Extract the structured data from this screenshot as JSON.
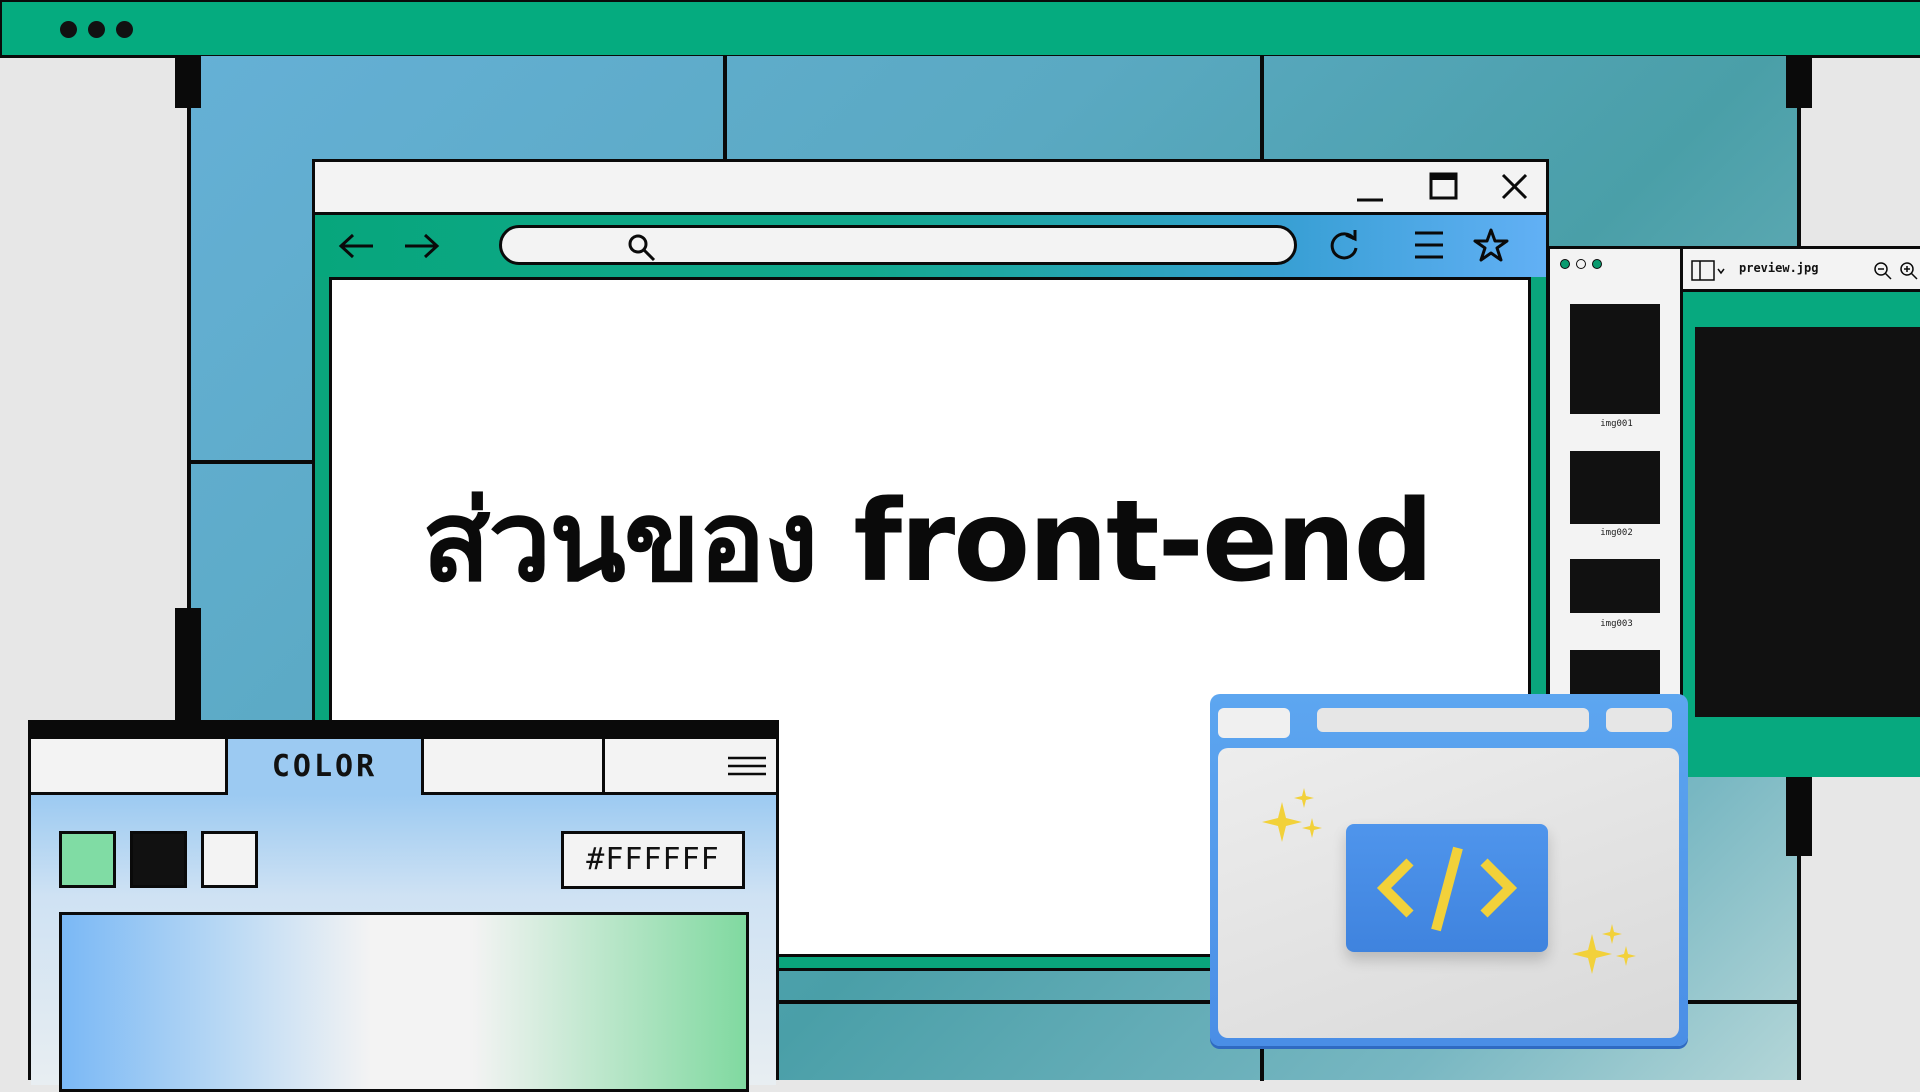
{
  "top_bar": {
    "window_dots": [
      "dot",
      "dot",
      "dot"
    ]
  },
  "browser": {
    "icons": {
      "minimize": "minimize-icon",
      "maximize": "maximize-icon",
      "close": "close-icon",
      "back": "arrow-left-icon",
      "forward": "arrow-right-icon",
      "search": "search-icon",
      "reload": "reload-icon",
      "menu": "hamburger-menu-icon",
      "bookmark": "star-icon"
    },
    "url_value": "",
    "headline": "ส่วนของ front-end"
  },
  "image_viewer": {
    "file_name": "preview.jpg",
    "thumbnails": [
      {
        "label": "img001"
      },
      {
        "label": "img002"
      },
      {
        "label": "img003"
      },
      {
        "label": ""
      }
    ]
  },
  "color_panel": {
    "tabs": [
      "",
      "COLOR",
      "",
      ""
    ],
    "active_tab": "COLOR",
    "swatches": [
      "#80dca4",
      "#111111",
      "#f3f3f3"
    ],
    "hex_value": "#FFFFFF"
  },
  "code_window": {
    "traffic_lights": [
      "#f08a7a",
      "#f2cf4a",
      "#8bd15b"
    ],
    "icon": "code-brackets-icon",
    "sparkles": [
      "sparkle-icon",
      "sparkle-icon"
    ]
  },
  "colors": {
    "accent_green": "#05ab7f",
    "panel_blue": "#5aa9c2",
    "outline": "#0a0a0a"
  }
}
